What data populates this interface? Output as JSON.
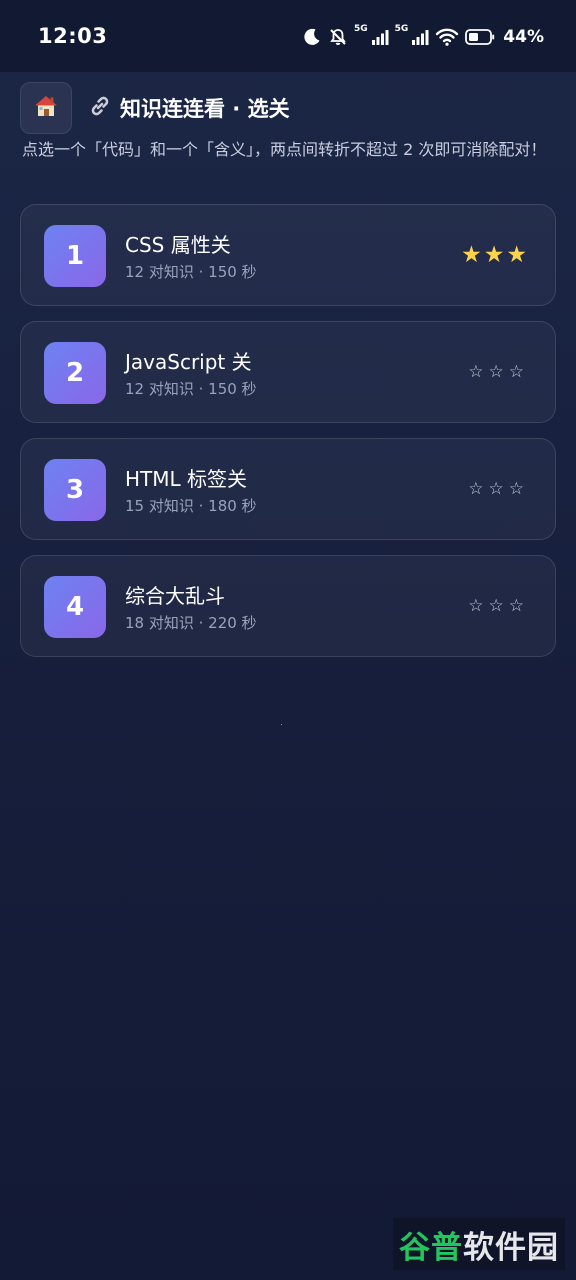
{
  "status_bar": {
    "time": "12:03",
    "network_1": "5G",
    "network_2": "5G",
    "battery": "44%",
    "icons": [
      "moon-icon",
      "bell-muted-icon",
      "signal-icon",
      "signal-icon",
      "wifi-icon",
      "battery-icon"
    ]
  },
  "header": {
    "home_icon": "house-icon",
    "title_icon": "link-icon",
    "title": "知识连连看 · 选关",
    "subtitle": "点选一个「代码」和一个「含义」，两点间转折不超过 2 次即可消除配对！"
  },
  "levels": [
    {
      "number": "1",
      "name": "CSS 属性关",
      "meta": "12 对知识 · 150 秒",
      "stars_earned": "★★★",
      "stars_empty": "",
      "rating": 3
    },
    {
      "number": "2",
      "name": "JavaScript 关",
      "meta": "12 对知识 · 150 秒",
      "stars_earned": "",
      "stars_empty": "☆☆☆",
      "rating": 0
    },
    {
      "number": "3",
      "name": "HTML 标签关",
      "meta": "15 对知识 · 180 秒",
      "stars_earned": "",
      "stars_empty": "☆☆☆",
      "rating": 0
    },
    {
      "number": "4",
      "name": "综合大乱斗",
      "meta": "18 对知识 · 220 秒",
      "stars_earned": "",
      "stars_empty": "☆☆☆",
      "rating": 0
    }
  ],
  "watermark": {
    "part_a": "谷普",
    "part_b": "软件园"
  },
  "colors": {
    "accent_start": "#6d82f2",
    "accent_end": "#8a67e8",
    "star_gold": "#fcd34d",
    "background": "#161e3b"
  }
}
